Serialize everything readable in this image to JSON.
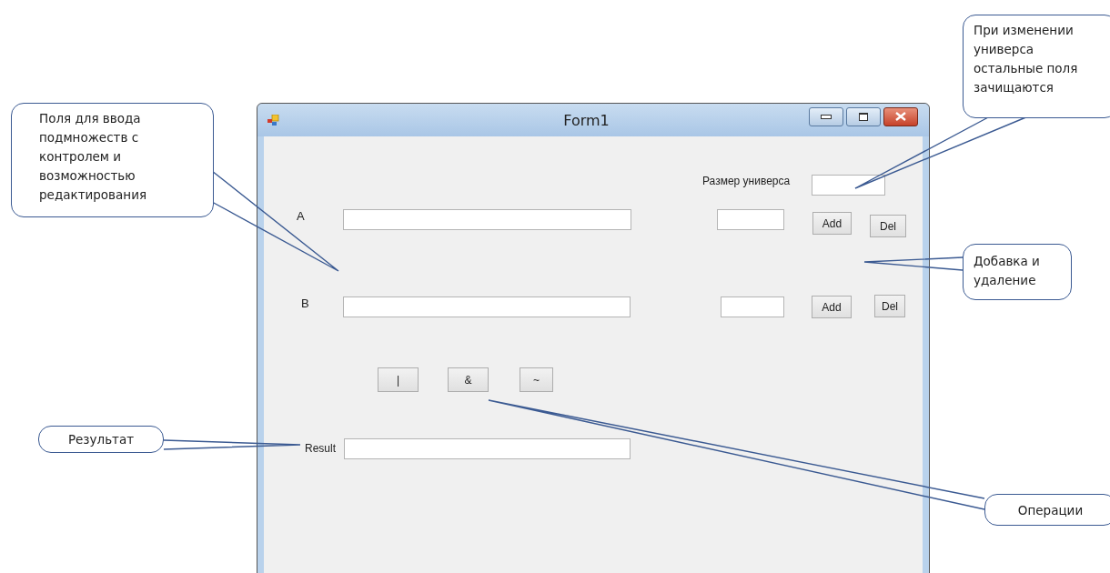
{
  "window": {
    "title": "Form1"
  },
  "form": {
    "universe": {
      "label": "Размер универса"
    },
    "sets": [
      {
        "label": "A",
        "add": "Add",
        "del": "Del"
      },
      {
        "label": "B",
        "add": "Add",
        "del": "Del"
      }
    ],
    "operations": [
      "|",
      "&",
      "~"
    ],
    "result": {
      "label": "Result"
    }
  },
  "callouts": [
    {
      "text": "Поля для ввода\nподмножеств с\nконтролем и\nвозможностью\nредактирования"
    },
    {
      "text": "При изменении\nуниверса\nостальные поля\nзачищаются"
    },
    {
      "text": "Добавка и\nудаление"
    },
    {
      "text": "Результат"
    },
    {
      "text": "Операции"
    }
  ]
}
